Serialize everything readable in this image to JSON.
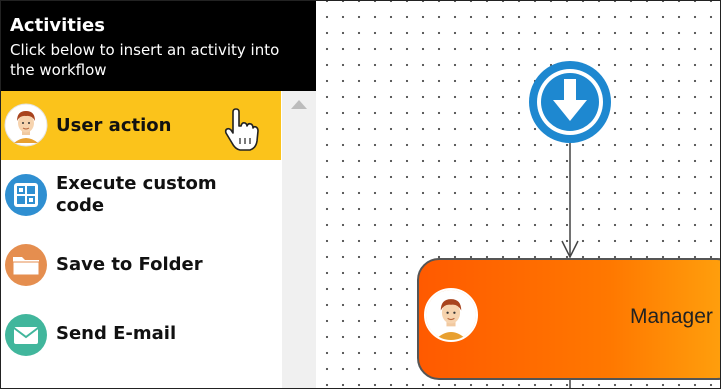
{
  "panel": {
    "title": "Activities",
    "subtitle": "Click below to insert an activity into the workflow"
  },
  "activities": [
    {
      "label": "User action",
      "icon": "user-avatar-icon",
      "active": true
    },
    {
      "label": "Execute custom code",
      "icon": "grid-code-icon",
      "active": false
    },
    {
      "label": "Save to Folder",
      "icon": "folder-icon",
      "active": false
    },
    {
      "label": "Send E-mail",
      "icon": "envelope-icon",
      "active": false
    }
  ],
  "workflow": {
    "start_icon": "download-arrow-icon",
    "node": {
      "label": "Manager",
      "icon": "user-avatar-icon"
    }
  },
  "colors": {
    "header_bg": "#000000",
    "active_item_bg": "#fbc31b",
    "start_node_blue": "#1e88d0",
    "node_orange_start": "#ff5a00",
    "node_orange_end": "#ffa40e"
  }
}
